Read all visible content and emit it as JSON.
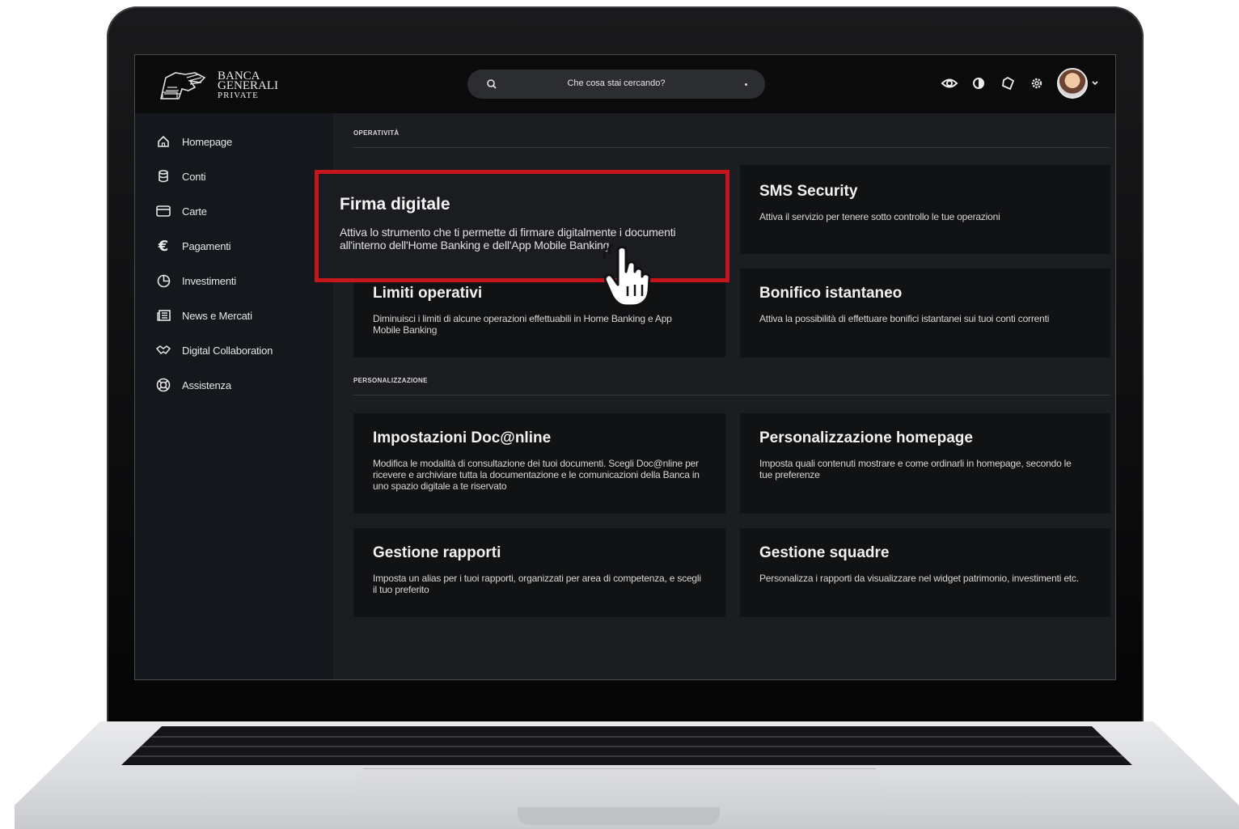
{
  "brand": {
    "name_line1": "BANCA",
    "name_line2": "GENERALI",
    "name_line3": "PRIVATE"
  },
  "search": {
    "placeholder": "Che cosa stai cercando?"
  },
  "toolbar": {
    "icons": [
      "eye-icon",
      "contrast-icon",
      "tag-icon",
      "gear-icon"
    ],
    "avatar": "user-avatar"
  },
  "sidebar": {
    "items": [
      {
        "label": "Homepage",
        "icon": "home-icon"
      },
      {
        "label": "Conti",
        "icon": "database-icon"
      },
      {
        "label": "Carte",
        "icon": "card-icon"
      },
      {
        "label": "Pagamenti",
        "icon": "euro-icon"
      },
      {
        "label": "Investimenti",
        "icon": "pie-chart-icon"
      },
      {
        "label": "News e Mercati",
        "icon": "newspaper-icon"
      },
      {
        "label": "Digital Collaboration",
        "icon": "handshake-icon"
      },
      {
        "label": "Assistenza",
        "icon": "lifebuoy-icon"
      }
    ]
  },
  "sections": {
    "operativita": {
      "label": "OPERATIVITÀ",
      "cards": [
        {
          "title": "Firma digitale",
          "desc": "Attiva lo strumento che ti permette di firmare digitalmente i documenti all'interno dell'Home Banking e dell'App Mobile Banking"
        },
        {
          "title": "SMS Security",
          "desc": "Attiva il servizio per tenere sotto controllo le tue operazioni"
        },
        {
          "title": "Limiti operativi",
          "desc": "Diminuisci i limiti di alcune operazioni effettuabili in Home Banking e App Mobile Banking"
        },
        {
          "title": "Bonifico istantaneo",
          "desc": "Attiva la possibilità di effettuare bonifici istantanei sui tuoi conti correnti"
        }
      ]
    },
    "personalizzazione": {
      "label": "PERSONALIZZAZIONE",
      "cards": [
        {
          "title": "Impostazioni Doc@nline",
          "desc": "Modifica le modalità di consultazione dei tuoi documenti. Scegli Doc@nline per ricevere e archiviare tutta la documentazione e le comunicazioni della Banca in uno spazio digitale a te riservato"
        },
        {
          "title": "Personalizzazione homepage",
          "desc": "Imposta quali contenuti mostrare e come ordinarli in homepage, secondo le tue preferenze"
        },
        {
          "title": "Gestione rapporti",
          "desc": "Imposta un alias per i tuoi rapporti, organizzati per area di competenza, e scegli il tuo preferito"
        },
        {
          "title": "Gestione squadre",
          "desc": "Personalizza i rapporti da visualizzare nel widget patrimonio, investimenti etc."
        }
      ]
    }
  },
  "colors": {
    "highlight_border": "#c4161c",
    "background": "#1b1d20",
    "card": "#111214"
  }
}
